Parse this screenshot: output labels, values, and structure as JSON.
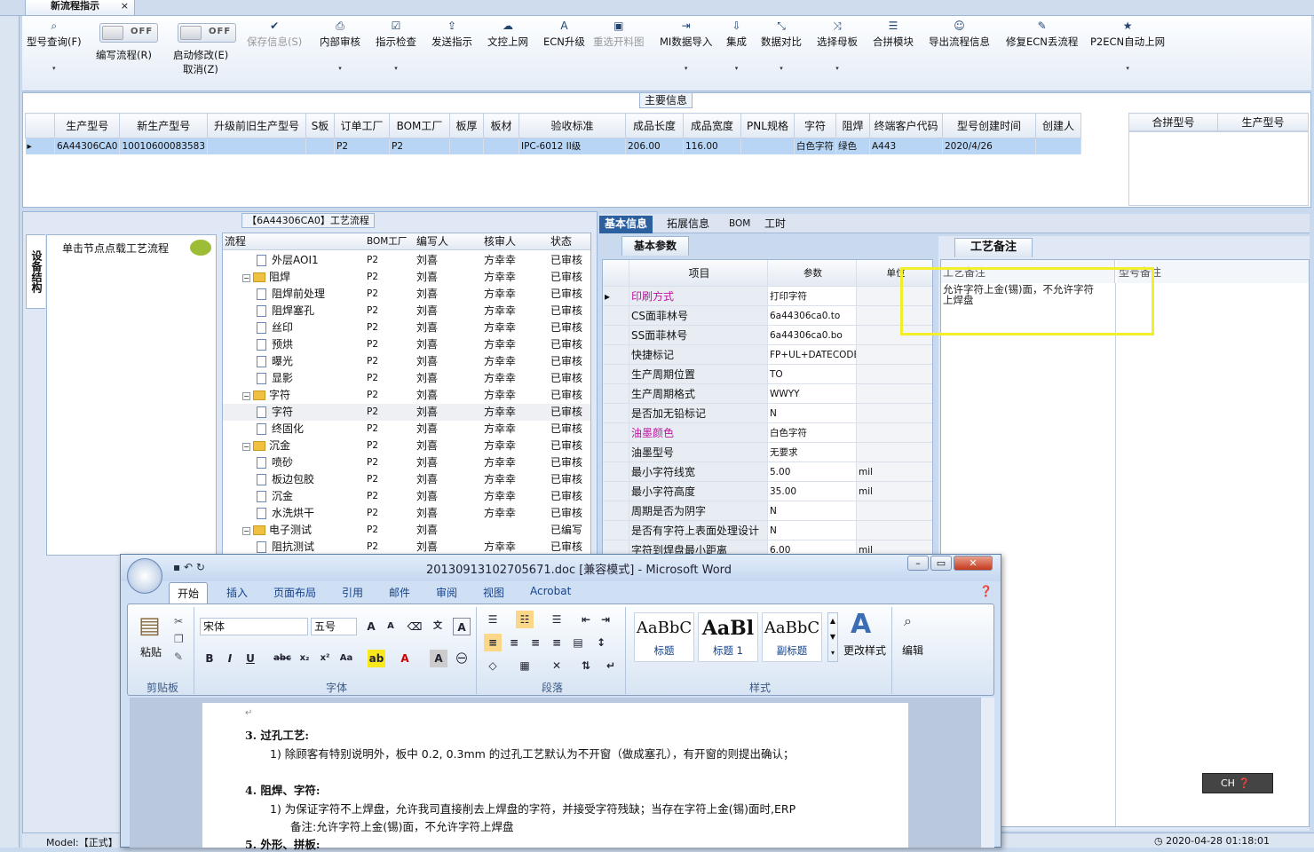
{
  "window": {
    "tab_title": "新流程指示",
    "tab_close": "×"
  },
  "toolbar": {
    "buttons": [
      {
        "label": "型号查询(F)",
        "icon": "search-icon"
      },
      {
        "label": "编写流程(R)",
        "icon": "toggle"
      },
      {
        "label": "启动修改(E)",
        "label2": "取消(Z)",
        "icon": "toggle"
      },
      {
        "label": "保存信息(S)",
        "icon": "check-icon"
      },
      {
        "label": "内部审核",
        "icon": "printer-icon"
      },
      {
        "label": "指示检查",
        "icon": "checklist-icon"
      },
      {
        "label": "发送指示",
        "icon": "upload-icon"
      },
      {
        "label": "文控上网",
        "icon": "cloud-upload-icon"
      },
      {
        "label": "ECN升级",
        "icon": "font-icon"
      },
      {
        "label": "重选开料图",
        "icon": "image-icon"
      },
      {
        "label": "MI数据导入",
        "icon": "import-icon"
      },
      {
        "label": "集成",
        "icon": "download-icon"
      },
      {
        "label": "数据对比",
        "icon": "compare-icon"
      },
      {
        "label": "选择母板",
        "icon": "shuffle-icon"
      },
      {
        "label": "合拼模块",
        "icon": "list-icon"
      },
      {
        "label": "导出流程信息",
        "icon": "smile-icon"
      },
      {
        "label": "修复ECN丢流程",
        "icon": "wrench-icon"
      },
      {
        "label": "P2ECN自动上网",
        "icon": "star-icon"
      }
    ],
    "toggle_off": "OFF",
    "drop": "▾"
  },
  "main_info": {
    "title": "主要信息",
    "columns": [
      "生产型号",
      "新生产型号",
      "升级前旧生产型号",
      "S板",
      "订单工厂",
      "BOM工厂",
      "板厚",
      "板材",
      "验收标准",
      "成品长度",
      "成品宽度",
      "PNL规格",
      "字符",
      "阻焊",
      "终端客户代码",
      "型号创建时间",
      "创建人"
    ],
    "row": [
      "6A44306CA0",
      "10010600083583",
      "",
      "",
      "P2",
      "P2",
      "",
      "",
      "IPC-6012 II级",
      "206.00",
      "116.00",
      "",
      "白色字符",
      "绿色",
      "A443",
      "2020/4/26",
      ""
    ],
    "side_columns": [
      "合拼型号",
      "生产型号"
    ]
  },
  "flow": {
    "title": "【6A44306CA0】工艺流程",
    "side_tab": "设备结构",
    "load_hint": "单击节点点载工艺流程",
    "columns": [
      "流程",
      "BOM工厂",
      "编写人",
      "核审人",
      "状态"
    ],
    "rows": [
      {
        "name": "外层AOI1",
        "bom": "P2",
        "editor": "刘喜",
        "reviewer": "方幸幸",
        "status": "已审核",
        "level": 2
      },
      {
        "name": "阻焊",
        "bom": "P2",
        "editor": "刘喜",
        "reviewer": "方幸幸",
        "status": "已审核",
        "level": 1
      },
      {
        "name": "阻焊前处理",
        "bom": "P2",
        "editor": "刘喜",
        "reviewer": "方幸幸",
        "status": "已审核",
        "level": 2
      },
      {
        "name": "阻焊塞孔",
        "bom": "P2",
        "editor": "刘喜",
        "reviewer": "方幸幸",
        "status": "已审核",
        "level": 2
      },
      {
        "name": "丝印",
        "bom": "P2",
        "editor": "刘喜",
        "reviewer": "方幸幸",
        "status": "已审核",
        "level": 2
      },
      {
        "name": "预烘",
        "bom": "P2",
        "editor": "刘喜",
        "reviewer": "方幸幸",
        "status": "已审核",
        "level": 2
      },
      {
        "name": "曝光",
        "bom": "P2",
        "editor": "刘喜",
        "reviewer": "方幸幸",
        "status": "已审核",
        "level": 2
      },
      {
        "name": "显影",
        "bom": "P2",
        "editor": "刘喜",
        "reviewer": "方幸幸",
        "status": "已审核",
        "level": 2
      },
      {
        "name": "字符",
        "bom": "P2",
        "editor": "刘喜",
        "reviewer": "方幸幸",
        "status": "已审核",
        "level": 1
      },
      {
        "name": "字符",
        "bom": "P2",
        "editor": "刘喜",
        "reviewer": "方幸幸",
        "status": "已审核",
        "level": 2
      },
      {
        "name": "终固化",
        "bom": "P2",
        "editor": "刘喜",
        "reviewer": "方幸幸",
        "status": "已审核",
        "level": 2
      },
      {
        "name": "沉金",
        "bom": "P2",
        "editor": "刘喜",
        "reviewer": "方幸幸",
        "status": "已审核",
        "level": 1
      },
      {
        "name": "喷砂",
        "bom": "P2",
        "editor": "刘喜",
        "reviewer": "方幸幸",
        "status": "已审核",
        "level": 2
      },
      {
        "name": "板边包胶",
        "bom": "P2",
        "editor": "刘喜",
        "reviewer": "方幸幸",
        "status": "已审核",
        "level": 2
      },
      {
        "name": "沉金",
        "bom": "P2",
        "editor": "刘喜",
        "reviewer": "方幸幸",
        "status": "已审核",
        "level": 2
      },
      {
        "name": "水洗烘干",
        "bom": "P2",
        "editor": "刘喜",
        "reviewer": "方幸幸",
        "status": "已审核",
        "level": 2
      },
      {
        "name": "电子测试",
        "bom": "P2",
        "editor": "刘喜",
        "reviewer": "",
        "status": "已编写",
        "level": 1
      },
      {
        "name": "阻抗测试",
        "bom": "P2",
        "editor": "刘喜",
        "reviewer": "方幸幸",
        "status": "已审核",
        "level": 2
      }
    ]
  },
  "basic": {
    "tabs": [
      "基本信息",
      "拓展信息",
      "BOM",
      "工时"
    ],
    "subtab": "基本参数",
    "columns": [
      "项目",
      "参数",
      "单位"
    ],
    "rows": [
      {
        "item": "印刷方式",
        "value": "打印字符",
        "unit": "",
        "color": "#c0139f"
      },
      {
        "item": "CS面菲林号",
        "value": "6a44306ca0.to",
        "unit": ""
      },
      {
        "item": "SS面菲林号",
        "value": "6a44306ca0.bo",
        "unit": ""
      },
      {
        "item": "快捷标记",
        "value": "FP+UL+DATECODE",
        "unit": ""
      },
      {
        "item": "生产周期位置",
        "value": "TO",
        "unit": ""
      },
      {
        "item": "生产周期格式",
        "value": "WWYY",
        "unit": ""
      },
      {
        "item": "是否加无铅标记",
        "value": "N",
        "unit": ""
      },
      {
        "item": "油墨颜色",
        "value": "白色字符",
        "unit": "",
        "color": "#c0139f"
      },
      {
        "item": "油墨型号",
        "value": "无要求",
        "unit": ""
      },
      {
        "item": "最小字符线宽",
        "value": "5.00",
        "unit": "mil"
      },
      {
        "item": "最小字符高度",
        "value": "35.00",
        "unit": "mil"
      },
      {
        "item": "周期是否为阴字",
        "value": "N",
        "unit": ""
      },
      {
        "item": "是否有字符上表面处理设计",
        "value": "N",
        "unit": ""
      },
      {
        "item": "字符到焊盘最小距离",
        "value": "6.00",
        "unit": "mil"
      }
    ]
  },
  "remarks": {
    "tab": "工艺备注",
    "col1": "工艺备注",
    "col2": "型号备注",
    "text": "允许字符上金(锡)面，不允许字符上焊盘"
  },
  "status": {
    "model": "Model:【正式】",
    "datetime": "2020-04-28 01:18:01",
    "ime": "CH"
  },
  "word": {
    "title": "20130913102705671.doc [兼容模式] - Microsoft Word",
    "tabs": [
      "开始",
      "插入",
      "页面布局",
      "引用",
      "邮件",
      "审阅",
      "视图",
      "Acrobat"
    ],
    "font": "宋体",
    "size": "五号",
    "groups": [
      "剪贴板",
      "字体",
      "段落",
      "样式"
    ],
    "paste": "粘贴",
    "styles": [
      {
        "sample": "AaBbC",
        "name": "标题"
      },
      {
        "sample": "AaBl",
        "name": "标题 1"
      },
      {
        "sample": "AaBbC",
        "name": "副标题"
      }
    ],
    "change_style": "更改样式",
    "edit": "编辑",
    "lines": [
      "3.  过孔工艺:",
      "1)  除顾客有特别说明外，板中 0.2, 0.3mm 的过孔工艺默认为不开窗（做成塞孔），有开窗的则提出确认；",
      "4.  阻焊、字符:",
      "1)  为保证字符不上焊盘，允许我司直接削去上焊盘的字符，并接受字符残缺；当存在字符上金(锡)面时,ERP",
      "备注:允许字符上金(锡)面，不允许字符上焊盘",
      "5.  外形、拼板:"
    ]
  }
}
